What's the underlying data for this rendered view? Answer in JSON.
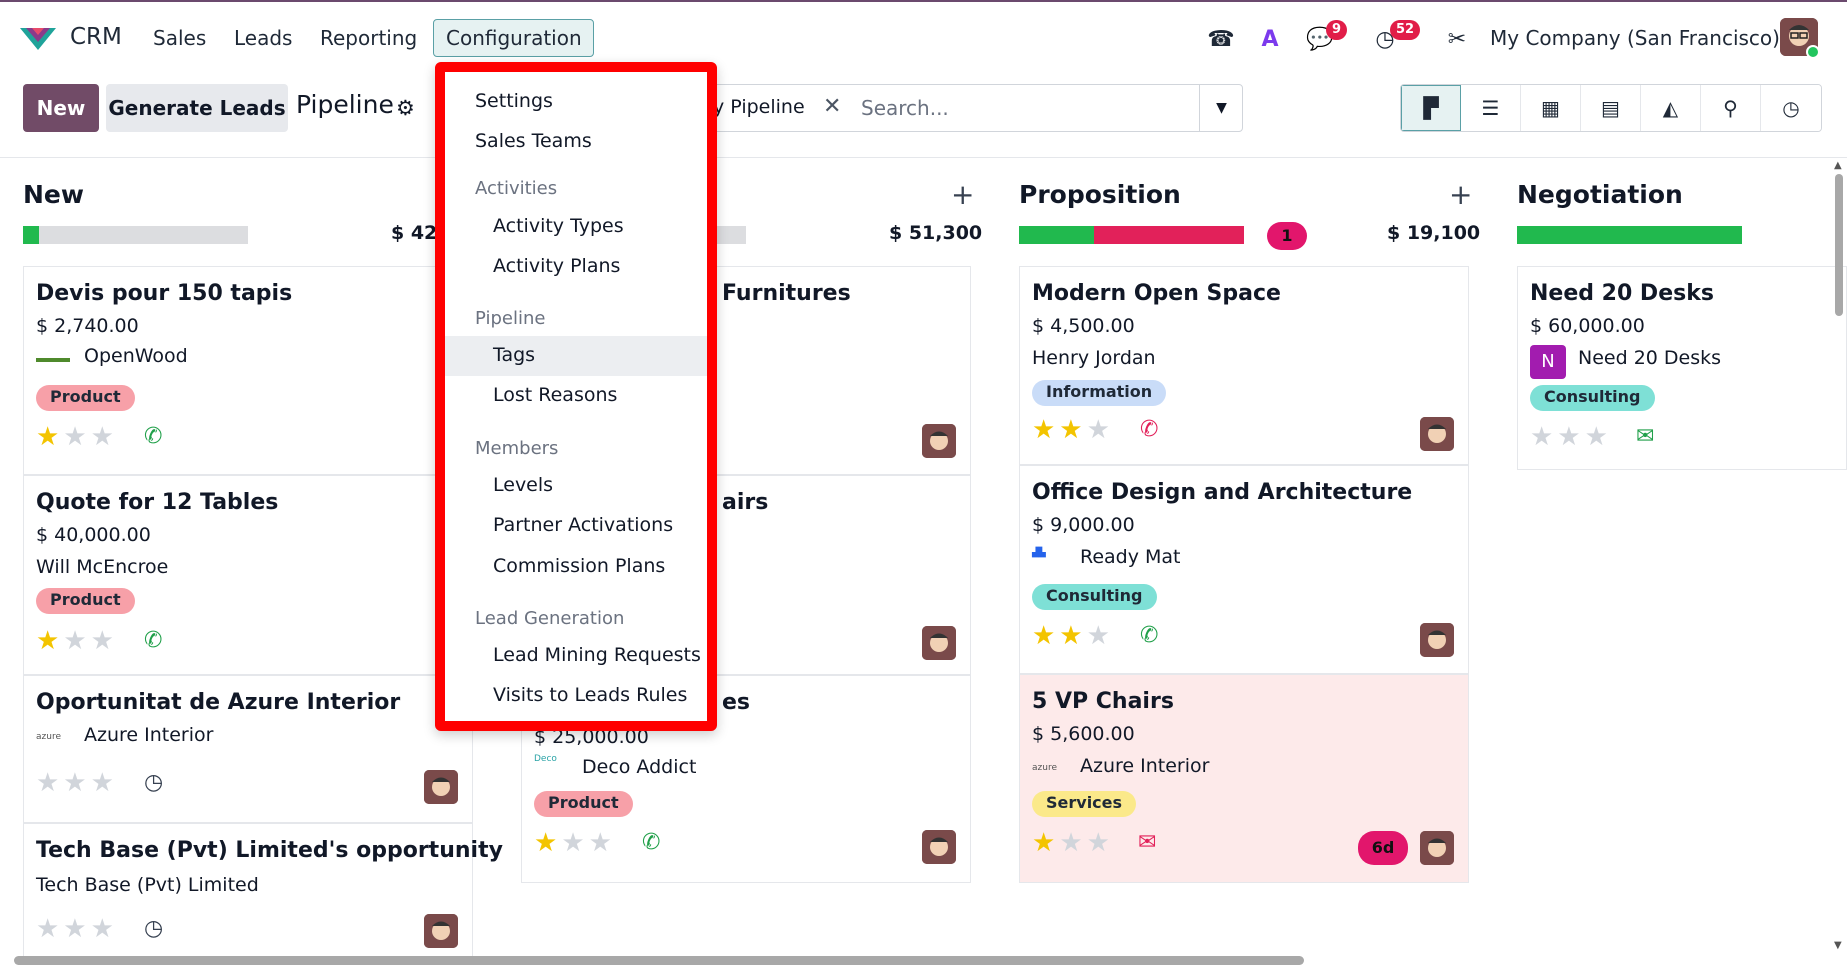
{
  "topbar": {
    "app_name": "CRM",
    "menus": [
      "Sales",
      "Leads",
      "Reporting",
      "Configuration"
    ],
    "chat_badge": "9",
    "activity_badge": "52",
    "company": "My Company (San Francisco)"
  },
  "control_panel": {
    "new_label": "New",
    "generate_label": "Generate Leads",
    "title": "Pipeline",
    "facet_label": "y Pipeline",
    "search_placeholder": "Search...",
    "views": [
      "kanban",
      "list",
      "calendar",
      "pivot",
      "graph",
      "map",
      "activity"
    ]
  },
  "columns": [
    {
      "title": "New",
      "total": "$ 42,",
      "cards": [
        {
          "title": "Devis pour 150 tapis",
          "amount": "$ 2,740.00",
          "partner": "OpenWood",
          "tag": "Product",
          "stars": 1
        },
        {
          "title": "Quote for 12 Tables",
          "amount": "$ 40,000.00",
          "partner": "Will McEncroe",
          "tag": "Product",
          "stars": 1
        },
        {
          "title": "Oportunitat de Azure Interior",
          "partner": "Azure Interior",
          "stars": 0
        },
        {
          "title": "Tech Base (Pvt) Limited's opportunity",
          "partner": "Tech Base (Pvt) Limited",
          "stars": 0
        }
      ]
    },
    {
      "title": "",
      "total": "$ 51,300",
      "cards": [
        {
          "title": "Furnitures",
          "stars": 0
        },
        {
          "title": "airs",
          "stars": 0
        },
        {
          "title": "es",
          "amount": "$ 25,000.00",
          "partner": "Deco Addict",
          "tag": "Product",
          "stars": 1
        }
      ]
    },
    {
      "title": "Proposition",
      "total": "$ 19,100",
      "overdue_count": "1",
      "cards": [
        {
          "title": "Modern Open Space",
          "amount": "$ 4,500.00",
          "partner": "Henry Jordan",
          "tag": "Information",
          "stars": 2
        },
        {
          "title": "Office Design and Architecture",
          "amount": "$ 9,000.00",
          "partner": "Ready Mat",
          "tag": "Consulting",
          "stars": 2
        },
        {
          "title": "5 VP Chairs",
          "amount": "$ 5,600.00",
          "partner": "Azure Interior",
          "tag": "Services",
          "stars": 1,
          "days": "6d"
        }
      ]
    },
    {
      "title": "Negotiation",
      "cards": [
        {
          "title": "Need 20 Desks",
          "amount": "$ 60,000.00",
          "partner": "Need 20 Desks",
          "partner_initial": "N",
          "tag": "Consulting",
          "stars": 0
        }
      ]
    }
  ],
  "config_menu": {
    "settings": "Settings",
    "sales_teams": "Sales Teams",
    "activities_header": "Activities",
    "activity_types": "Activity Types",
    "activity_plans": "Activity Plans",
    "pipeline_header": "Pipeline",
    "tags": "Tags",
    "lost_reasons": "Lost Reasons",
    "members_header": "Members",
    "levels": "Levels",
    "partner_activations": "Partner Activations",
    "commission_plans": "Commission Plans",
    "lead_gen_header": "Lead Generation",
    "lead_mining": "Lead Mining Requests",
    "visits_rules": "Visits to Leads Rules"
  },
  "colors": {
    "brand": "#714b67",
    "highlight_border": "#ff0000",
    "product_tag": "#f7a0a8",
    "information_tag": "#c9dcf8",
    "consulting_tag": "#7ee0d6",
    "services_tag": "#fbe98a"
  }
}
